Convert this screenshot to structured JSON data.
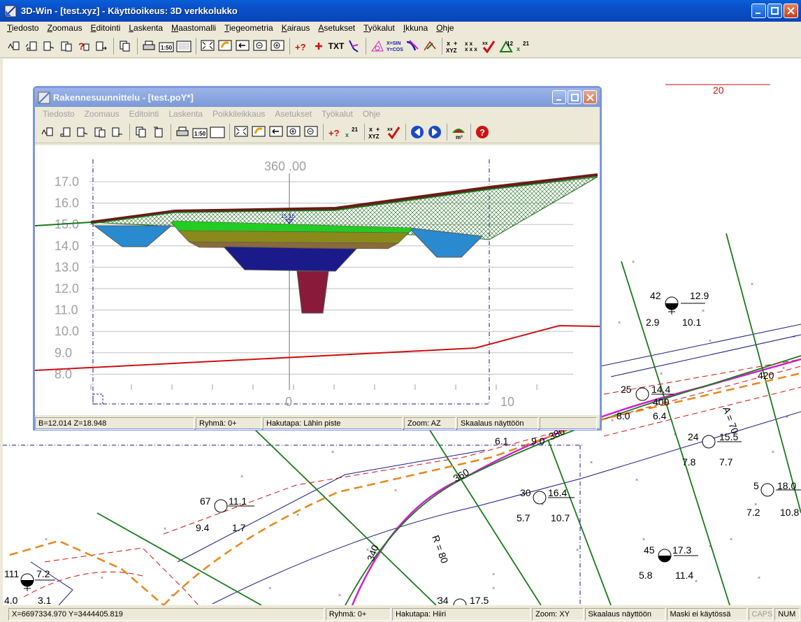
{
  "window": {
    "title": "3D-Win - [test.xyz] - Käyttöoikeus: 3D verkkolukko"
  },
  "menu": [
    {
      "u": "T",
      "rest": "iedosto"
    },
    {
      "u": "Z",
      "rest": "oomaus"
    },
    {
      "u": "E",
      "rest": "ditointi"
    },
    {
      "u": "L",
      "rest": "askenta"
    },
    {
      "u": "M",
      "rest": "aastomalli"
    },
    {
      "u": "T",
      "rest": "iegeometria"
    },
    {
      "u": "K",
      "rest": "airaus"
    },
    {
      "u": "A",
      "rest": "setukset"
    },
    {
      "u": "T",
      "rest": "yökalut"
    },
    {
      "u": "I",
      "rest": "kkuna"
    },
    {
      "u": "O",
      "rest": "hje"
    }
  ],
  "toolbar": {
    "scale_label": "1:50",
    "txt_label": "TXT",
    "sincos_label": "X=SIN\nY=COS",
    "xyz_label": "XYZ",
    "n12_label": "12",
    "n21_label": "21"
  },
  "map": {
    "labels": [
      {
        "text": "20",
        "color": "#d01010"
      },
      {
        "text": "42",
        "color": "#000"
      },
      {
        "text": "12.9",
        "color": "#000"
      },
      {
        "text": "2.9",
        "color": "#000"
      },
      {
        "text": "10.1",
        "color": "#000"
      },
      {
        "text": "25",
        "color": "#000"
      },
      {
        "text": "14.4",
        "color": "#000"
      },
      {
        "text": "400",
        "color": "#000"
      },
      {
        "text": "8.0",
        "color": "#000"
      },
      {
        "text": "6.4",
        "color": "#000"
      },
      {
        "text": "420",
        "color": "#000"
      },
      {
        "text": "A = 70",
        "color": "#000"
      },
      {
        "text": "24",
        "color": "#000"
      },
      {
        "text": "15.5",
        "color": "#000"
      },
      {
        "text": "7.8",
        "color": "#000"
      },
      {
        "text": "7.7",
        "color": "#000"
      },
      {
        "text": "5",
        "color": "#000"
      },
      {
        "text": "18.0",
        "color": "#000"
      },
      {
        "text": "7.2",
        "color": "#000"
      },
      {
        "text": "10.8",
        "color": "#000"
      },
      {
        "text": "6.1",
        "color": "#000"
      },
      {
        "text": "9.0",
        "color": "#000"
      },
      {
        "text": "380",
        "color": "#000"
      },
      {
        "text": "67",
        "color": "#000"
      },
      {
        "text": "11.1",
        "color": "#000"
      },
      {
        "text": "9.4",
        "color": "#000"
      },
      {
        "text": "1.7",
        "color": "#000"
      },
      {
        "text": "360",
        "color": "#000"
      },
      {
        "text": "30",
        "color": "#000"
      },
      {
        "text": "16.4",
        "color": "#000"
      },
      {
        "text": "5.7",
        "color": "#000"
      },
      {
        "text": "10.7",
        "color": "#000"
      },
      {
        "text": "R = 80",
        "color": "#000"
      },
      {
        "text": "340",
        "color": "#000"
      },
      {
        "text": "45",
        "color": "#000"
      },
      {
        "text": "17.3",
        "color": "#000"
      },
      {
        "text": "5.8",
        "color": "#000"
      },
      {
        "text": "11.4",
        "color": "#000"
      },
      {
        "text": "111",
        "color": "#000"
      },
      {
        "text": "7.2",
        "color": "#000"
      },
      {
        "text": "4.0",
        "color": "#000"
      },
      {
        "text": "3.1",
        "color": "#000"
      },
      {
        "text": "34",
        "color": "#000"
      },
      {
        "text": "17.5",
        "color": "#000"
      }
    ]
  },
  "child": {
    "title": "Rakennesuunnittelu - [test.poY*]",
    "menu": [
      "Tiedosto",
      "Zoomaus",
      "Editointi",
      "Laskenta",
      "Poikkileikkaus",
      "Asetukset",
      "Työkalut",
      "Ohje"
    ],
    "section_label": "360 .00",
    "ticks_y": [
      "17.0",
      "16.0",
      "15.0",
      "14.0",
      "13.0",
      "12.0",
      "11.0",
      "10.0",
      "9.0",
      "8.0"
    ],
    "ticks_x": [
      "0",
      "10"
    ],
    "point_label": "15.16",
    "status": {
      "coords": "B=12.014  Z=18.948",
      "group": "Ryhmä: 0+",
      "snap": "Hakutapa: Lähin piste",
      "zoom": "Zoom: AZ",
      "scale": "Skaalaus näyttöön"
    }
  },
  "status": {
    "coords": "X=6697334.970  Y=3444405.819",
    "group": "Ryhmä: 0+",
    "snap": "Hakutapa: Hiiri",
    "zoom": "Zoom: XY",
    "scale": "Skaalaus näyttöön",
    "mask": "Maski ei käytössä",
    "caps": "CAPS",
    "num": "NUM"
  },
  "colors": {
    "titlebar": "#0a55d0",
    "road_green": "#1a7a1a",
    "contour_red": "#d01010",
    "orange_dash": "#e8861a",
    "road_magenta": "#d020d0",
    "navy": "#1a1a8a"
  }
}
